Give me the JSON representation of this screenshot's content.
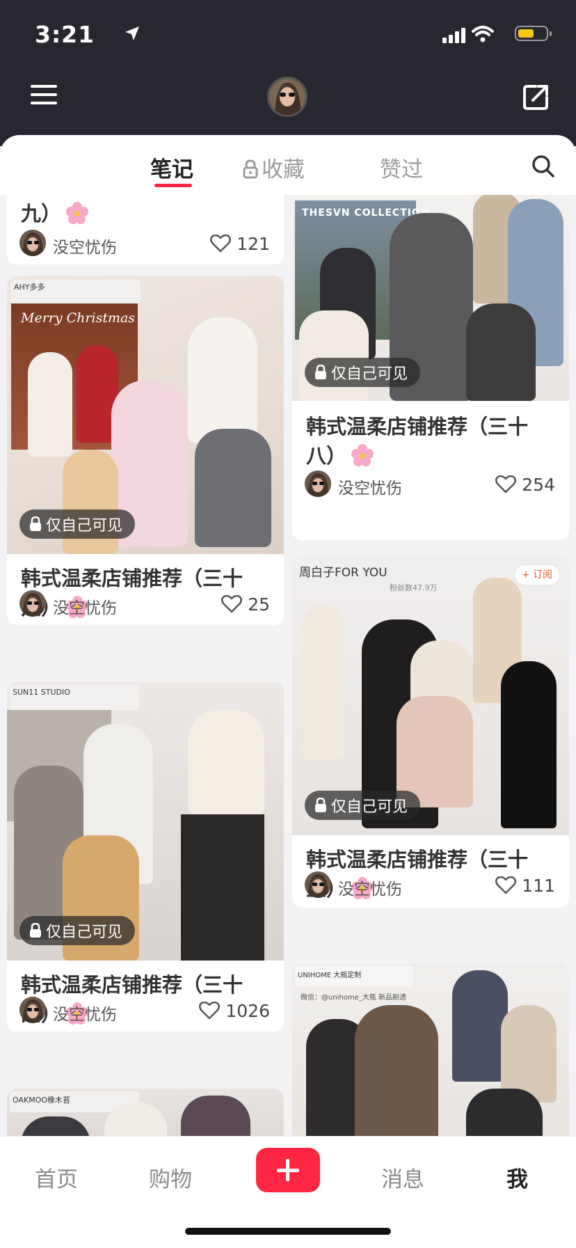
{
  "status": {
    "time": "3:21"
  },
  "header": {
    "menu_icon": "menu-icon",
    "share_icon": "share-icon"
  },
  "tabs": {
    "notes": "笔记",
    "collections": "收藏",
    "liked": "赞过"
  },
  "feed": {
    "left": [
      {
        "title_tail": "九）",
        "author": "没空忧伤",
        "likes": "121"
      },
      {
        "overlay_brand": "AHY多多",
        "overlay_text": "Merry Christmas",
        "badge": "仅自己可见",
        "title": "韩式温柔店铺推荐（三十六）",
        "author": "没空忧伤",
        "likes": "25"
      },
      {
        "overlay_brand": "SUN11 STUDIO",
        "badge": "仅自己可见",
        "title": "韩式温柔店铺推荐（三十四）",
        "author": "没空忧伤",
        "likes": "1026"
      },
      {
        "overlay_brand": "OAKMOO橡木苔"
      }
    ],
    "right": [
      {
        "overlay_brand": "THESVN COLLECTION",
        "badge": "仅自己可见",
        "title": "韩式温柔店铺推荐（三十八）",
        "author": "没空忧伤",
        "likes": "254"
      },
      {
        "overlay_brand": "周白子FOR YOU",
        "overlay_fans": "粉丝数47.9万",
        "overlay_sub": "+ 订阅",
        "badge": "仅自己可见",
        "title": "韩式温柔店铺推荐（三十五）",
        "author": "没空忧伤",
        "likes": "111"
      },
      {
        "overlay_brand": "UNIHOME 大瓶定制",
        "overlay_wechat": "微信：@unihome_大瓶 新品剧透"
      }
    ]
  },
  "bottom_nav": {
    "home": "首页",
    "shop": "购物",
    "messages": "消息",
    "me": "我"
  },
  "colors": {
    "accent": "#ff2741",
    "header_bg": "#28272f"
  }
}
